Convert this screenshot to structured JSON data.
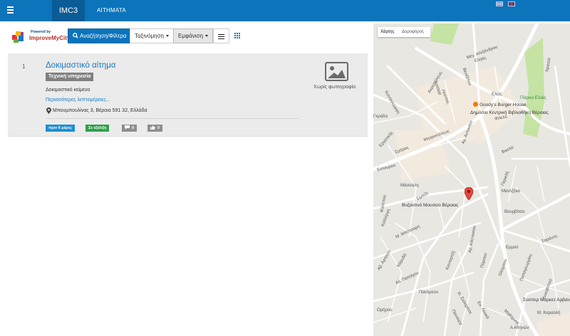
{
  "navbar": {
    "brand": "IMC3",
    "nav_link": "ΑΙΤΗΜΑΤΑ",
    "flags": [
      "greek-flag-icon",
      "english-flag-icon"
    ]
  },
  "logo": {
    "powered_by": "Powered by",
    "name": "ImproveMyCity"
  },
  "toolbar": {
    "search_label": "Αναζήτηση/Φίλτρα",
    "sort_label": "Ταξινόμηση",
    "view_label": "Εμφάνιση"
  },
  "issues": [
    {
      "number": "1",
      "title": "Δοκιμαστικό αίτημα",
      "category": "Τεχνική υπηρεσία",
      "description": "Δοκιμαστικό κείμενο",
      "more_link": "Περισσότερες λεπτομέρειες...",
      "address": "Μπουμπουλίνας 3, Βέροια 591 32, Ελλάδα",
      "time_badge": "πριν 6 μέρες",
      "status_badge": "Σε εξέλιξη",
      "comments": "0",
      "votes": "0",
      "no_photo": "Χωρίς φωτογραφία"
    }
  ],
  "map": {
    "tab_map": "Χάρτης",
    "tab_satellite": "Δορυφόρος",
    "streets": [
      "Μεγ. Αλεξάνδρου",
      "Εληάς",
      "Βενιζέλου",
      "Καταρρ",
      "Κοντογεώργη",
      "Μητροπόλεως",
      "Αγ. Αντωνίου",
      "Βικελά",
      "Μάσσαλη",
      "Καλλέργη",
      "Εργατικής",
      "Σμάρας",
      "Ελιάς",
      "Μαντζήκα",
      "Βουρβίτσα",
      "Ερμού",
      "Ολύμπου",
      "Πανάρεου",
      "Μ. Μπότσαρη",
      "Πύρσου",
      "Παπαγεωργίου",
      "Ομήρου",
      "Αγ. Αθανασίου",
      "Αλ. Παπάγου",
      "Γκράδα",
      "Εσταυρού",
      "Κανταρτζή",
      "Σαράντη",
      "Πανούργ",
      "Φιλίππου",
      "Λυκαβιττού",
      "Μ. Καραολή",
      "Αβ. Αρηνοσ",
      "Λέοντος",
      "Σιμιτζή",
      "Φιλελλ.",
      "Μηθύμνης",
      "Ακροπόλεως",
      "Ιλ. Σαλαμίνος",
      "Ευ. Λουκά",
      "Καρυδά",
      "Α Αθηνών"
    ],
    "pois": [
      "Goody's Burger House",
      "Δημόσια Κεντρική Βιβλιοθήκη Βέροιας",
      "Πάρκο Ελιάς",
      "Βυζαντινό Μουσείο Βέροιας",
      "Σούπερ Μάρκετ Αρβανιτίδης",
      "Ιτρατού",
      "Περικλή"
    ],
    "colors": {
      "road": "#ffffff",
      "park": "#c5e3a3",
      "block": "#f2eadf",
      "background": "#e9e7e2"
    }
  },
  "colors": {
    "primary": "#0b74bb",
    "link": "#1a7ac4",
    "badge_time": "#1b8fd2",
    "badge_status": "#2fa04a",
    "badge_gray": "#8e8e8e"
  }
}
